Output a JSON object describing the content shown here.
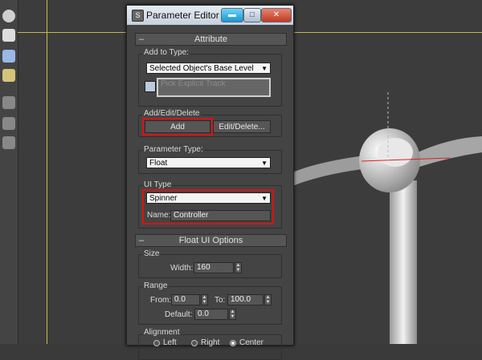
{
  "dialog": {
    "title": "Parameter Editor",
    "app_icon_glyph": "S",
    "window_buttons": {
      "minimize": "▬",
      "maximize": "□",
      "close": "✕"
    }
  },
  "attribute": {
    "header": "Attribute",
    "add_to_type": {
      "label": "Add to Type:",
      "value": "Selected Object's Base Level"
    },
    "pick_explicit_track": {
      "placeholder": "Pick Explicit Track"
    },
    "add_edit_delete": {
      "label": "Add/Edit/Delete",
      "add_label": "Add",
      "edit_delete_label": "Edit/Delete..."
    },
    "parameter_type": {
      "label": "Parameter Type:",
      "value": "Float"
    },
    "ui_type": {
      "label": "UI Type",
      "value": "Spinner",
      "name_label": "Name:",
      "name_value": "Controller"
    }
  },
  "float_ui": {
    "header": "Float UI Options",
    "size": {
      "label": "Size",
      "width_label": "Width:",
      "width_value": "160"
    },
    "range": {
      "label": "Range",
      "from_label": "From:",
      "from_value": "0.0",
      "to_label": "To:",
      "to_value": "100.0",
      "default_label": "Default:",
      "default_value": "0.0"
    },
    "alignment": {
      "label": "Alignment",
      "left": "Left",
      "right": "Right",
      "center": "Center",
      "selected": "Center"
    }
  },
  "colors": {
    "accent_red": "#dd1111",
    "viewport_grid_yellow": "#c8b84a"
  }
}
